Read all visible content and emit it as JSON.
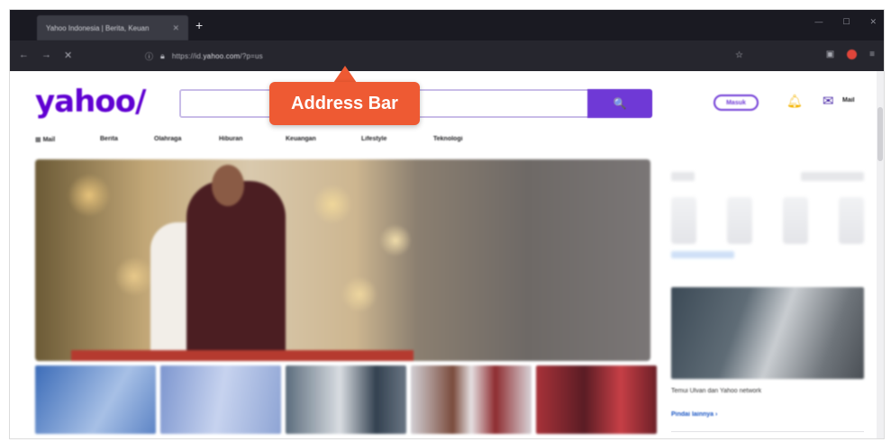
{
  "browser": {
    "tab_title": "Yahoo Indonesia | Berita, Keuan",
    "tab_close": "✕",
    "new_tab": "+",
    "window_controls": [
      "—",
      "☐",
      "✕"
    ],
    "nav": {
      "back": "←",
      "forward": "→",
      "reload": "✕"
    },
    "url_prefix": "https://id.",
    "url_domain": "yahoo.com",
    "url_path": "/?p=us",
    "bookmark": "☆",
    "menu": "≡"
  },
  "header": {
    "logo": "yahoo/",
    "search_placeholder": "",
    "search_icon": "🔍",
    "signin_label": "Masuk",
    "mail_label": "Mail"
  },
  "categories": [
    "Mail",
    "Berita",
    "Olahraga",
    "Hiburan",
    "Keuangan",
    "Lifestyle",
    "Teknologi"
  ],
  "hero": {
    "headline": "",
    "sub": ""
  },
  "promo": {
    "text": "Temui Ulvan dan Yahoo network",
    "link": "Pindai lainnya ›"
  },
  "callout": {
    "label": "Address Bar"
  },
  "colors": {
    "brand": "#6001d2",
    "callout": "#ee5a33",
    "chrome": "#1a1a22"
  }
}
